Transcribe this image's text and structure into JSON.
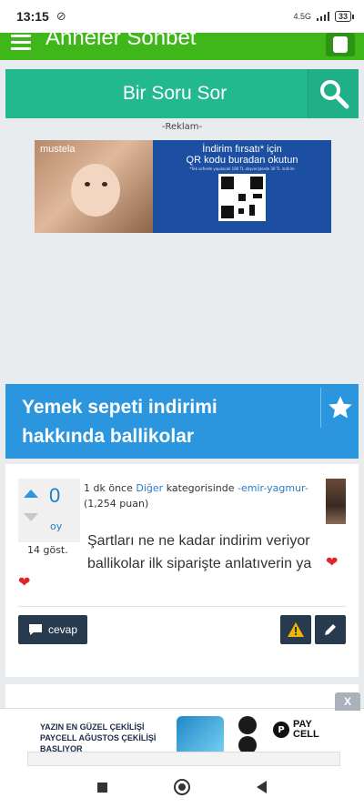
{
  "status_bar": {
    "time": "13:15",
    "network": "4.5G",
    "battery": "33"
  },
  "app_header": {
    "title": "Anneler Sohbet"
  },
  "ask_bar": {
    "label": "Bir Soru Sor"
  },
  "ad": {
    "label": "-Reklam-",
    "brand": "mustela",
    "line1": "İndirim fırsatı* için",
    "line2": "QR kodu buradan okutun",
    "fineprint": "*Tek seferde yapılacak 180 TL alışverişlerde 30 TL indirim"
  },
  "question": {
    "title": "Yemek sepeti indirimi hakkında ballikolar",
    "votes": "0",
    "vote_unit": "oy",
    "views": "14 göst.",
    "time_ago": "1 dk önce",
    "category": "Diğer",
    "category_suffix": "kategorisinde",
    "author": "-emir-yagmur-",
    "points": "(1,254 puan)",
    "body": "Şartları ne ne kadar indirim veriyor ballikolar ilk siparişte anlatıverin ya",
    "answer_label": "cevap"
  },
  "bottom_ad": {
    "close": "X",
    "line1": "YAZIN EN GÜZEL ÇEKİLİŞİ",
    "line2": "PAYCELL AĞUSTOS ÇEKİLİŞİ",
    "line3": "BAŞLIYOR",
    "brand_p": "P",
    "brand1": "PAY",
    "brand2": "CELL"
  },
  "colors": {
    "header_green": "#3fb619",
    "ask_teal": "#22b98f",
    "question_blue": "#2b95dd",
    "button_dark": "#283a4e",
    "heart_red": "#e0242c"
  }
}
